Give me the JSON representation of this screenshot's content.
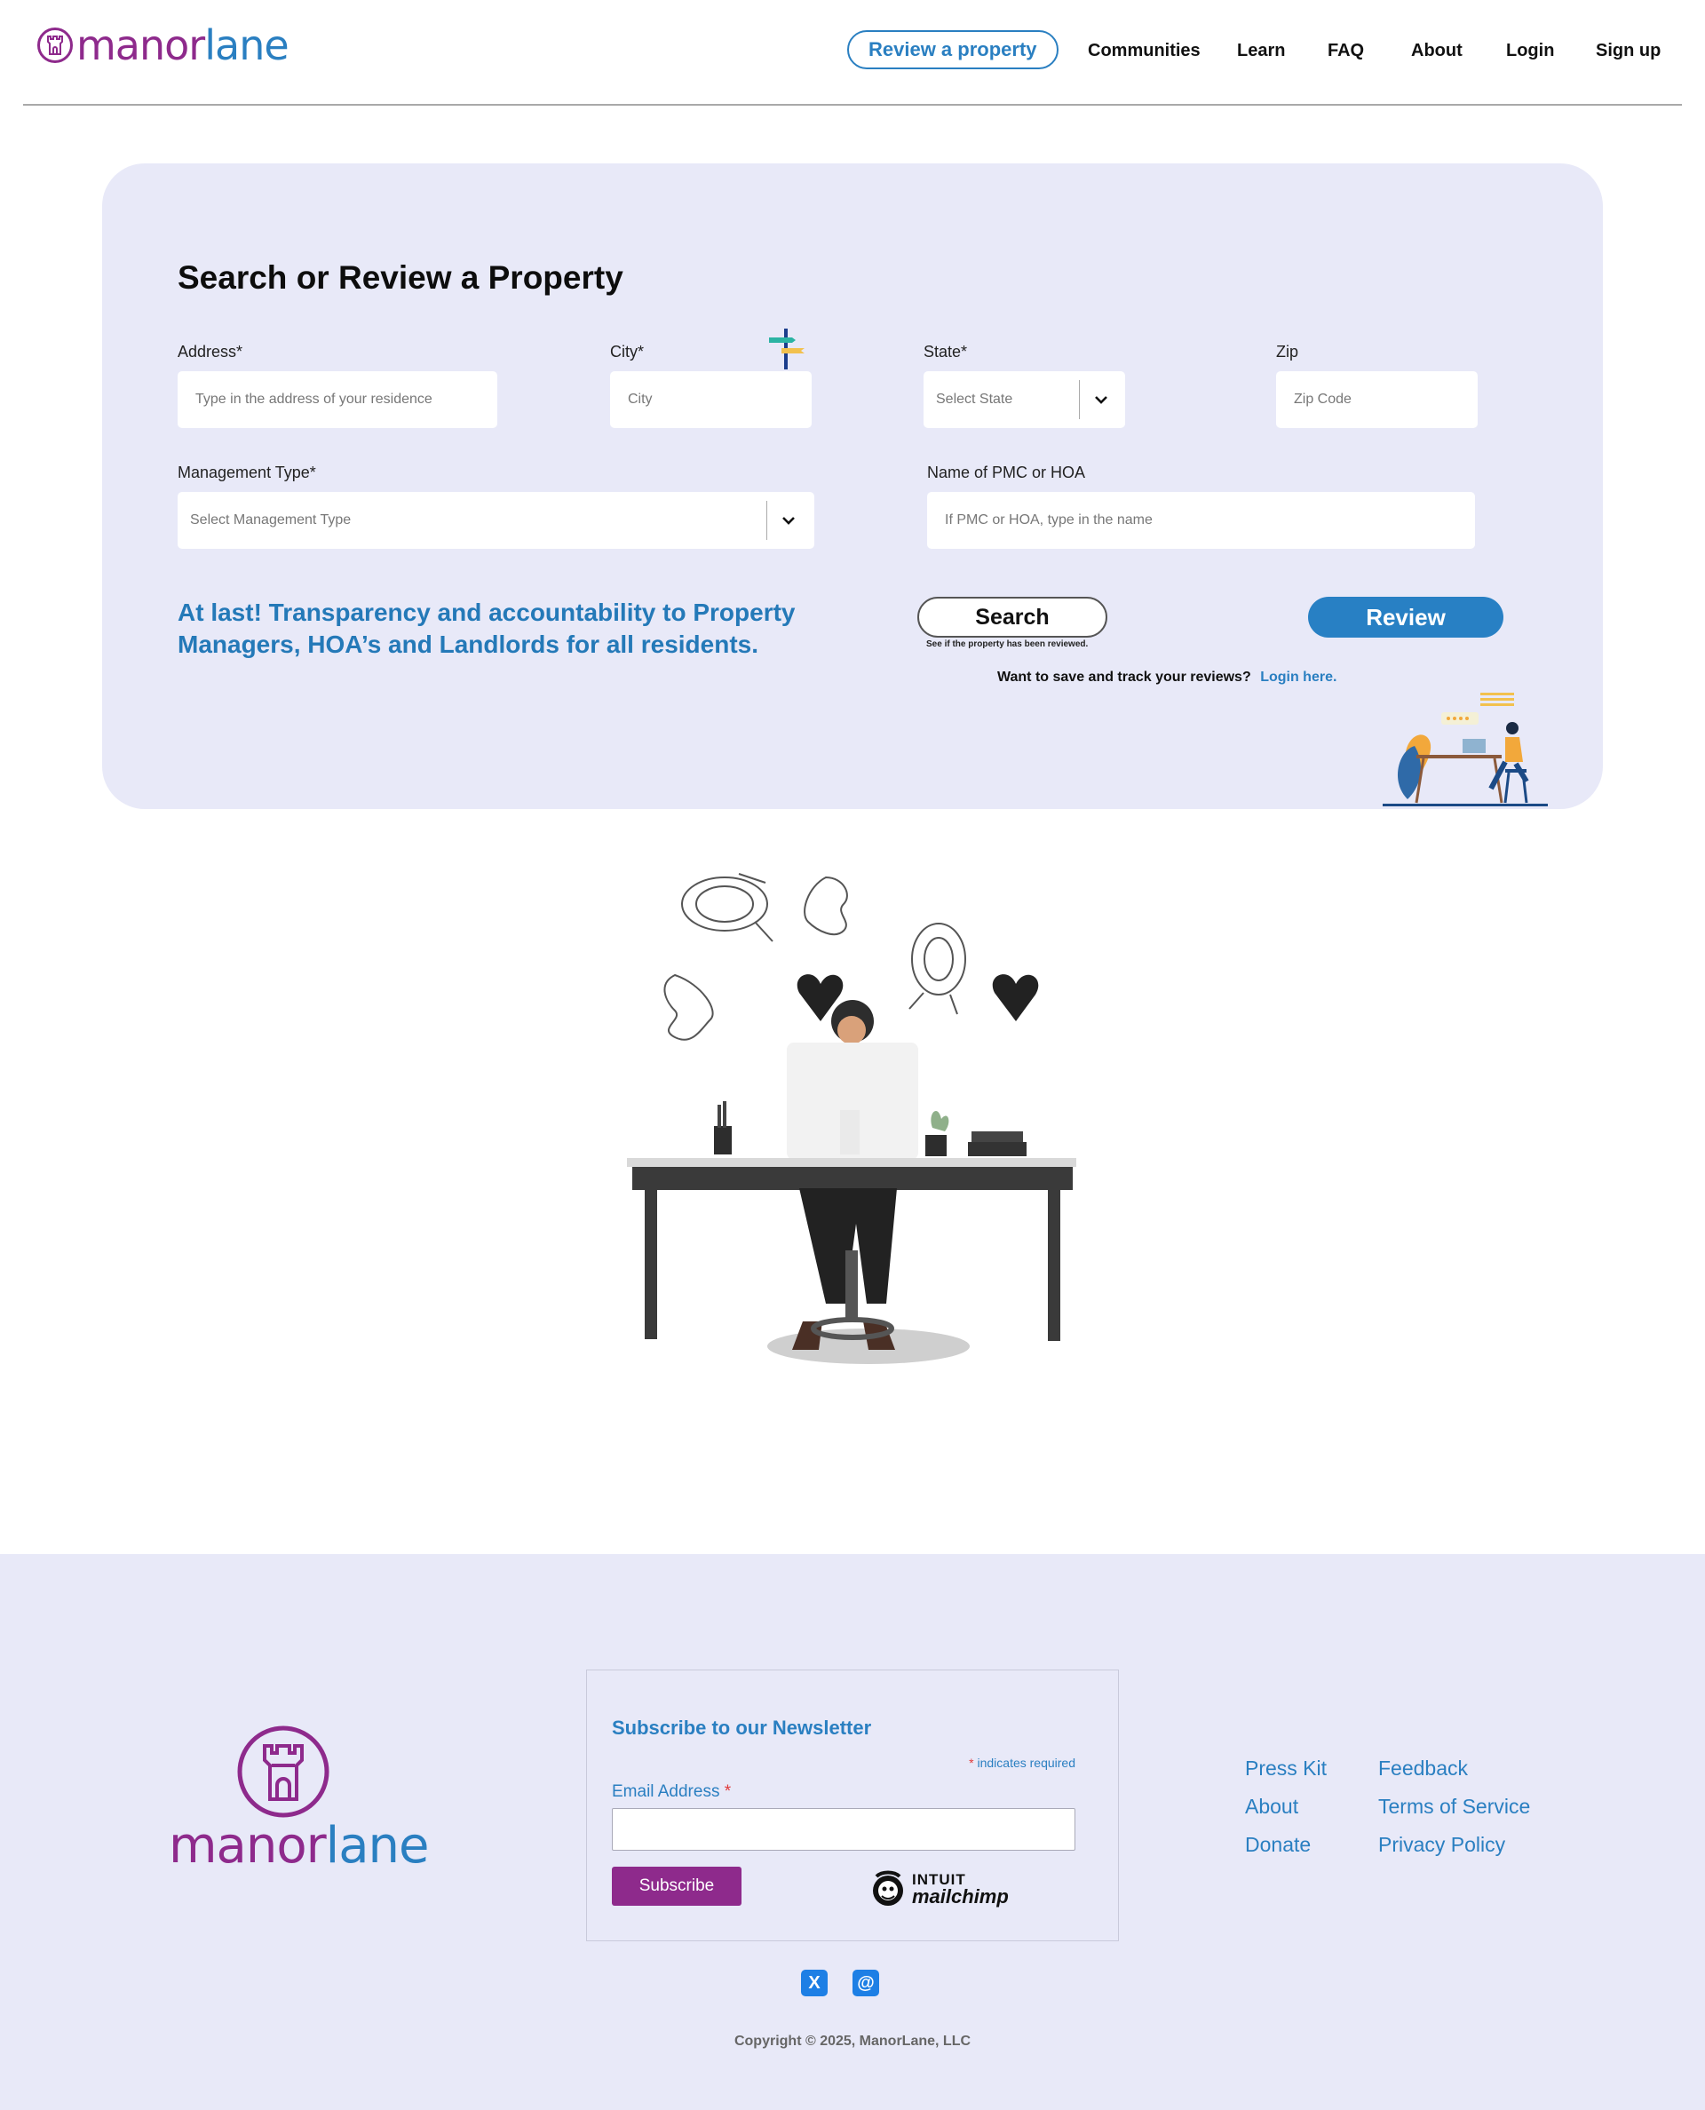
{
  "header": {
    "logo": {
      "part1": "manor",
      "part2": "lane"
    },
    "nav": {
      "review": "Review a property",
      "communities": "Communities",
      "learn": "Learn",
      "faq": "FAQ",
      "about": "About",
      "login": "Login",
      "signup": "Sign up"
    }
  },
  "form": {
    "title": "Search or Review a Property",
    "address": {
      "label": "Address*",
      "placeholder": "Type in the address of your residence"
    },
    "city": {
      "label": "City*",
      "placeholder": "City"
    },
    "state": {
      "label": "State*",
      "selected": "Select State"
    },
    "zip": {
      "label": "Zip",
      "placeholder": "Zip Code"
    },
    "management_type": {
      "label": "Management Type*",
      "selected": "Select Management Type"
    },
    "pmc_name": {
      "label": "Name of PMC or HOA",
      "placeholder": "If PMC or HOA, type in the name"
    },
    "tagline": "At last! Transparency and accountability to Property Managers, HOA’s and Landlords for all residents.",
    "search_button": "Search",
    "search_note": "See if the property has been reviewed.",
    "review_button": "Review",
    "login_prompt": "Want to save and track your reviews?",
    "login_link": "Login here."
  },
  "footer": {
    "logo": {
      "part1": "manor",
      "part2": "lane"
    },
    "newsletter": {
      "title": "Subscribe to our Newsletter",
      "required_star": "*",
      "required_note": "indicates required",
      "email_label": "Email Address",
      "email_star": "*",
      "subscribe": "Subscribe",
      "mailchimp_top": "INTUIT",
      "mailchimp_bottom": "mailchimp"
    },
    "links": {
      "press_kit": "Press Kit",
      "about": "About",
      "donate": "Donate",
      "feedback": "Feedback",
      "terms": "Terms of Service",
      "privacy": "Privacy Policy"
    },
    "social": {
      "x_icon": "X",
      "threads_icon": "@"
    },
    "copyright": "Copyright © 2025, ManorLane, LLC"
  },
  "colors": {
    "brand_purple": "#8e2a8c",
    "brand_blue": "#2a7fc1",
    "card_background": "#e8e9f8",
    "review_button": "#2880c4"
  },
  "icons": [
    "castle-logo-icon",
    "chevron-down-icon",
    "signpost-icon",
    "mailchimp-icon",
    "x-twitter-icon",
    "threads-icon"
  ]
}
